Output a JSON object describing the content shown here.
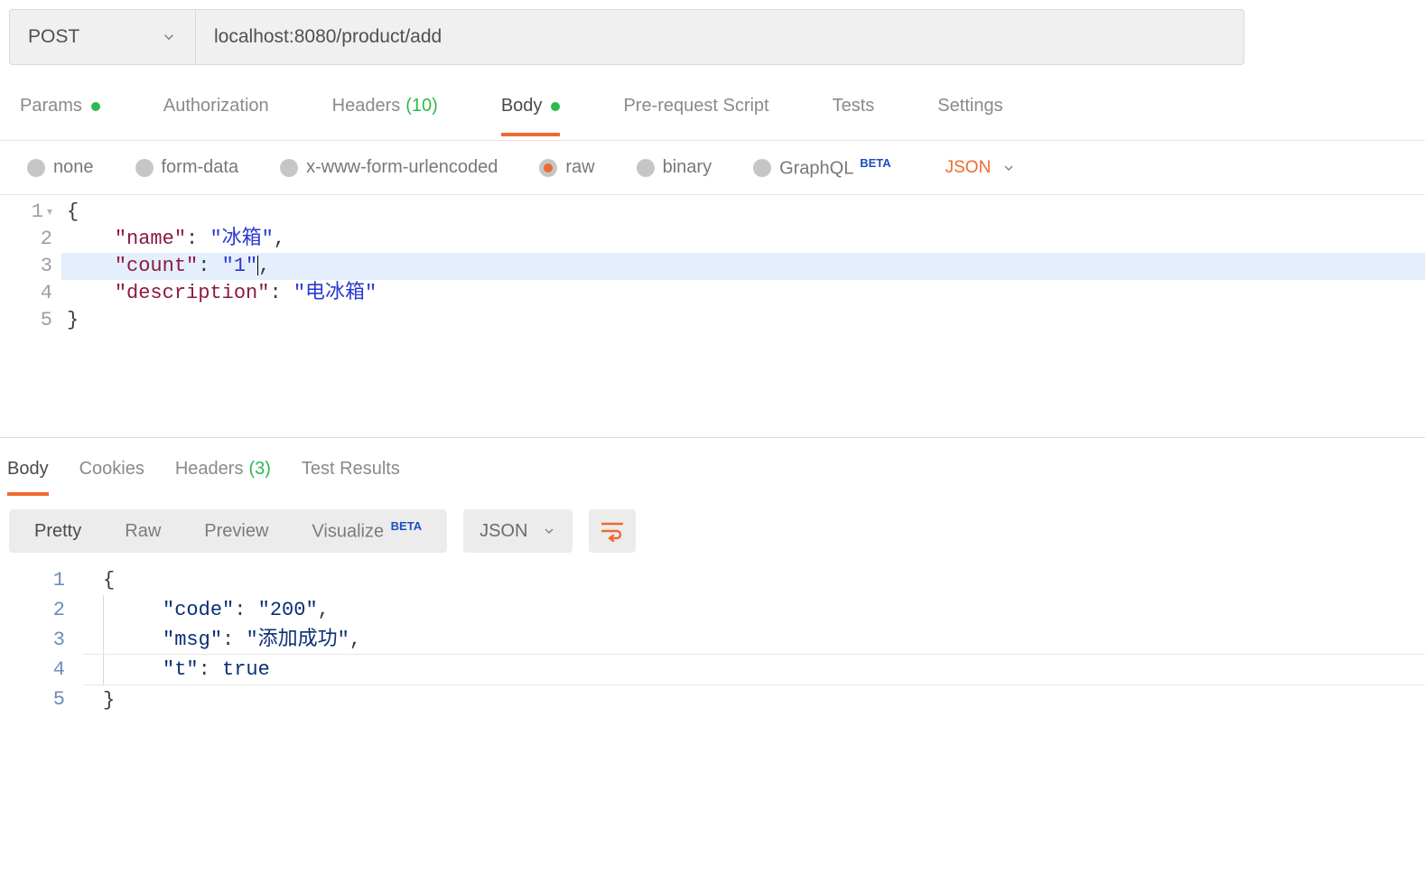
{
  "request": {
    "method": "POST",
    "url": "localhost:8080/product/add"
  },
  "tabs": {
    "params": "Params",
    "authorization": "Authorization",
    "headers": "Headers",
    "headers_count": "(10)",
    "body": "Body",
    "prerequest": "Pre-request Script",
    "tests": "Tests",
    "settings": "Settings"
  },
  "body_types": {
    "none": "none",
    "form_data": "form-data",
    "xwww": "x-www-form-urlencoded",
    "raw": "raw",
    "binary": "binary",
    "graphql": "GraphQL",
    "beta": "BETA",
    "content_type": "JSON"
  },
  "request_body": {
    "l1": "{",
    "l2_key": "\"name\"",
    "l2_val": "\"冰箱\"",
    "l3_key": "\"count\"",
    "l3_val": "\"1\"",
    "l4_key": "\"description\"",
    "l4_val": "\"电冰箱\"",
    "l5": "}"
  },
  "response_tabs": {
    "body": "Body",
    "cookies": "Cookies",
    "headers": "Headers",
    "headers_count": "(3)",
    "test_results": "Test Results"
  },
  "view_modes": {
    "pretty": "Pretty",
    "raw": "Raw",
    "preview": "Preview",
    "visualize": "Visualize",
    "beta": "BETA",
    "format": "JSON"
  },
  "response_body": {
    "l1": "{",
    "l2_key": "\"code\"",
    "l2_val": "\"200\"",
    "l3_key": "\"msg\"",
    "l3_val": "\"添加成功\"",
    "l4_key": "\"t\"",
    "l4_val": "true",
    "l5": "}"
  },
  "line_numbers": {
    "n1": "1",
    "n2": "2",
    "n3": "3",
    "n4": "4",
    "n5": "5"
  }
}
